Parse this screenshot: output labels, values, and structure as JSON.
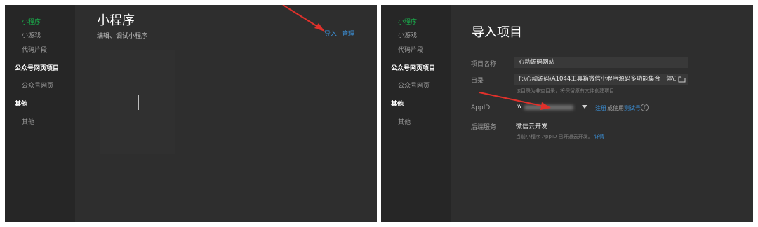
{
  "left": {
    "sidebar": {
      "items": [
        "小程序",
        "小游戏",
        "代码片段"
      ],
      "group1": "公众号网页项目",
      "group1_items": [
        "公众号网页"
      ],
      "group2": "其他",
      "group2_items": [
        "其他"
      ]
    },
    "title": "小程序",
    "subtitle": "编辑、调试小程序",
    "actions": {
      "import": "导入",
      "manage": "管理"
    }
  },
  "right": {
    "sidebar": {
      "items": [
        "小程序",
        "小游戏",
        "代码片段"
      ],
      "group1": "公众号网页项目",
      "group1_items": [
        "公众号网页"
      ],
      "group2": "其他",
      "group2_items": [
        "其他"
      ]
    },
    "title": "导入项目",
    "form": {
      "name_label": "项目名称",
      "name_value": "心动源码网站",
      "dir_label": "目录",
      "dir_value": "F:\\心动源码\\A1044工具箱微信小程序源码多功能集合一体\\工具",
      "dir_hint": "该目录为非空目录，将保留原有文件创建项目",
      "appid_label": "AppID",
      "appid_prefix": "w",
      "register": "注册",
      "or_use": "或使用",
      "test_account": "测试号",
      "help": "?",
      "backend_label": "后端服务",
      "backend_value": "微信云开发",
      "backend_hint": "当前小程序 AppID 已开通云开发。",
      "details": "详情"
    }
  },
  "colors": {
    "accent_green": "#19b44d",
    "link_blue": "#3b8fd6",
    "arrow_red": "#e0312b"
  }
}
